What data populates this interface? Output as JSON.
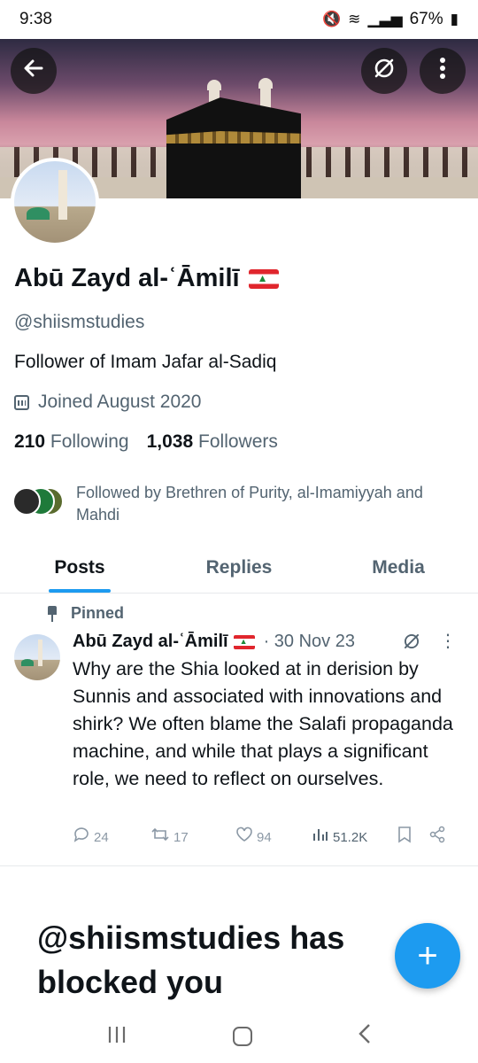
{
  "status_bar": {
    "time": "9:38",
    "battery": "67%",
    "icons": [
      "mute-icon",
      "wifi-icon",
      "signal-icon",
      "battery-icon"
    ]
  },
  "header": {
    "back_icon": "arrow-left-icon",
    "grok_icon": "grok-icon",
    "more_icon": "more-vertical-icon"
  },
  "profile": {
    "display_name": "Abū Zayd al-ʿĀmilī",
    "flag": "lebanon-flag",
    "handle": "@shiismstudies",
    "bio": "Follower of Imam Jafar al-Sadiq",
    "joined": "Joined August 2020",
    "following_count": "210",
    "following_label": "Following",
    "followers_count": "1,038",
    "followers_label": "Followers",
    "followed_by": "Followed by Brethren of Purity, al-Imamiyyah and Mahdi"
  },
  "tabs": [
    {
      "label": "Posts",
      "active": true
    },
    {
      "label": "Replies",
      "active": false
    },
    {
      "label": "Media",
      "active": false
    }
  ],
  "pinned_post": {
    "pinned_label": "Pinned",
    "author": "Abū Zayd al-ʿĀmilī",
    "date": "· 30 Nov 23",
    "text": "Why are the Shia looked at in derision by Sunnis and associated with innovations and shirk? We often blame the Salafi propaganda machine, and while that plays a significant role, we need to reflect on ourselves.",
    "replies": "24",
    "reposts": "17",
    "likes": "94",
    "views": "51.2K"
  },
  "blocked_message": "@shiismstudies has blocked you",
  "fab_icon": "plus-icon",
  "colors": {
    "accent": "#1d9bf0",
    "text": "#0f1419",
    "muted": "#536471"
  }
}
